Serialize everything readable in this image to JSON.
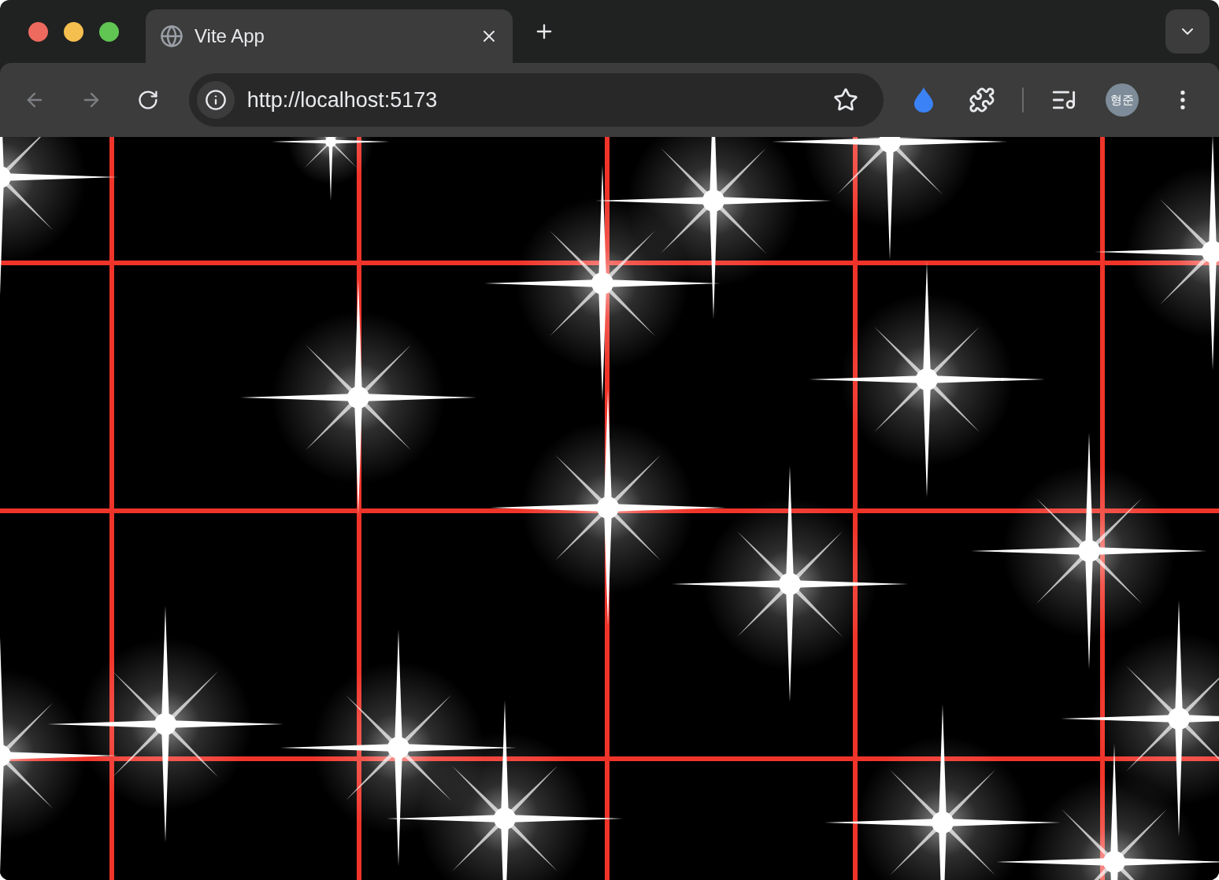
{
  "tabs": [
    {
      "title": "Vite App",
      "selected": true
    }
  ],
  "address_bar": {
    "url": "http://localhost:5173"
  },
  "profile": {
    "initials": "형준"
  }
}
